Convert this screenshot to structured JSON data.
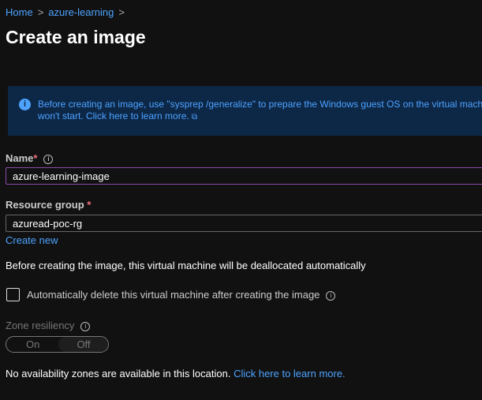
{
  "breadcrumb": {
    "items": [
      "Home",
      "azure-learning"
    ],
    "sep": ">"
  },
  "title": "Create an image",
  "info": {
    "line1": "Before creating an image, use \"sysprep /generalize\" to prepare the Windows guest OS on the virtual machi",
    "line2": "won't start. Click here to learn more.",
    "icon": "info-icon"
  },
  "name": {
    "label": "Name",
    "required": "*",
    "value": "azure-learning-image"
  },
  "resource_group": {
    "label": "Resource group",
    "required": "*",
    "value": "azuread-poc-rg",
    "create_new": "Create new"
  },
  "dealloc_note": "Before creating the image, this virtual machine will be deallocated automatically",
  "auto_delete": {
    "label": "Automatically delete this virtual machine after creating the image",
    "checked": false
  },
  "zone": {
    "label": "Zone resiliency",
    "on": "On",
    "off": "Off",
    "selected": "Off"
  },
  "zones_note": {
    "text": "No availability zones are available in this location.",
    "link": "Click here to learn more."
  }
}
